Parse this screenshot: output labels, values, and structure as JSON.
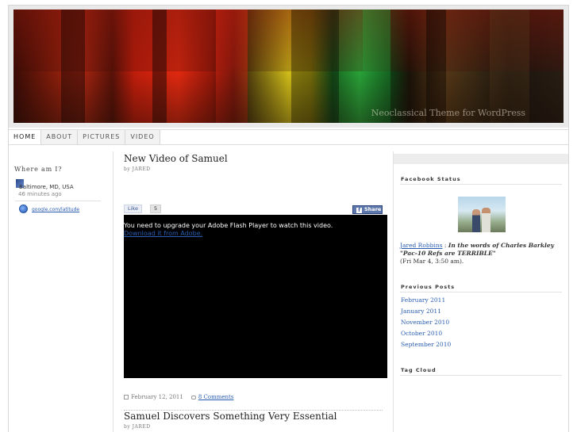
{
  "header": {
    "tagline": "Neoclassical Theme for WordPress"
  },
  "nav": {
    "items": [
      "Home",
      "About",
      "Pictures",
      "Video"
    ]
  },
  "sidebar_left": {
    "title": "Where am I?",
    "location": "Baltimore, MD, USA",
    "time_ago": "46 minutes ago",
    "latitude_link": "google.com/latitude"
  },
  "posts": [
    {
      "title": "New Video of Samuel",
      "byline": "by JARED",
      "like_label": "Like",
      "like_count": "5",
      "share_label": "Share",
      "share_fb_glyph": "f",
      "video_message": "You need to upgrade your Adobe Flash Player to watch this video.",
      "video_link": "Download it from Adobe.",
      "date": "February 12, 2011",
      "comments": "8 Comments"
    },
    {
      "title": "Samuel Discovers Something Very Essential",
      "byline": "by JARED"
    }
  ],
  "sidebar_right": {
    "facebook_title": "Facebook Status",
    "status_name": "Jared Robbins",
    "status_separator": " : ",
    "status_quote": "In the words of Charles Barkley \"Pac-10 Refs are TERRIBLE\"",
    "status_time": "(Fri Mar 4, 3:50 am).",
    "previous_title": "Previous Posts",
    "previous_posts": [
      "February 2011",
      "January 2011",
      "November 2010",
      "October 2010",
      "September 2010"
    ],
    "tagcloud_title": "Tag Cloud"
  },
  "colors": {
    "link": "#2a5db0",
    "facebook": "#5f78ab"
  }
}
